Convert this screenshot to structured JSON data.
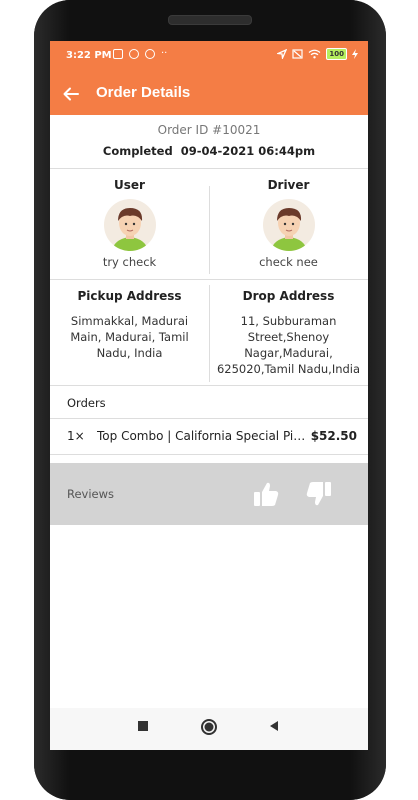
{
  "status_bar": {
    "time": "3:22 PM",
    "dots": "··",
    "battery": "100"
  },
  "app_bar": {
    "title": "Order Details",
    "back_icon": "arrow-left-icon"
  },
  "order": {
    "id": "Order ID #10021",
    "status": "Completed",
    "datetime": "09-04-2021 06:44pm"
  },
  "user": {
    "title": "User",
    "name": "try check"
  },
  "driver": {
    "title": "Driver",
    "name": "check nee"
  },
  "pickup": {
    "title": "Pickup Address",
    "text": "Simmakkal, Madurai Main, Madurai, Tamil Nadu, India"
  },
  "drop": {
    "title": "Drop Address",
    "text": "11, Subburaman Street,Shenoy Nagar,Madurai, 625020,Tamil Nadu,India"
  },
  "orders": {
    "label": "Orders",
    "items": [
      {
        "qty": "1×",
        "name": "Top Combo | California Special Pizza",
        "price": "$52.50"
      }
    ]
  },
  "reviews": {
    "label": "Reviews",
    "like_icon": "thumbs-up-icon",
    "dislike_icon": "thumbs-down-icon"
  },
  "colors": {
    "accent": "#f47d45",
    "reviews_bg": "#d3d3d3"
  }
}
